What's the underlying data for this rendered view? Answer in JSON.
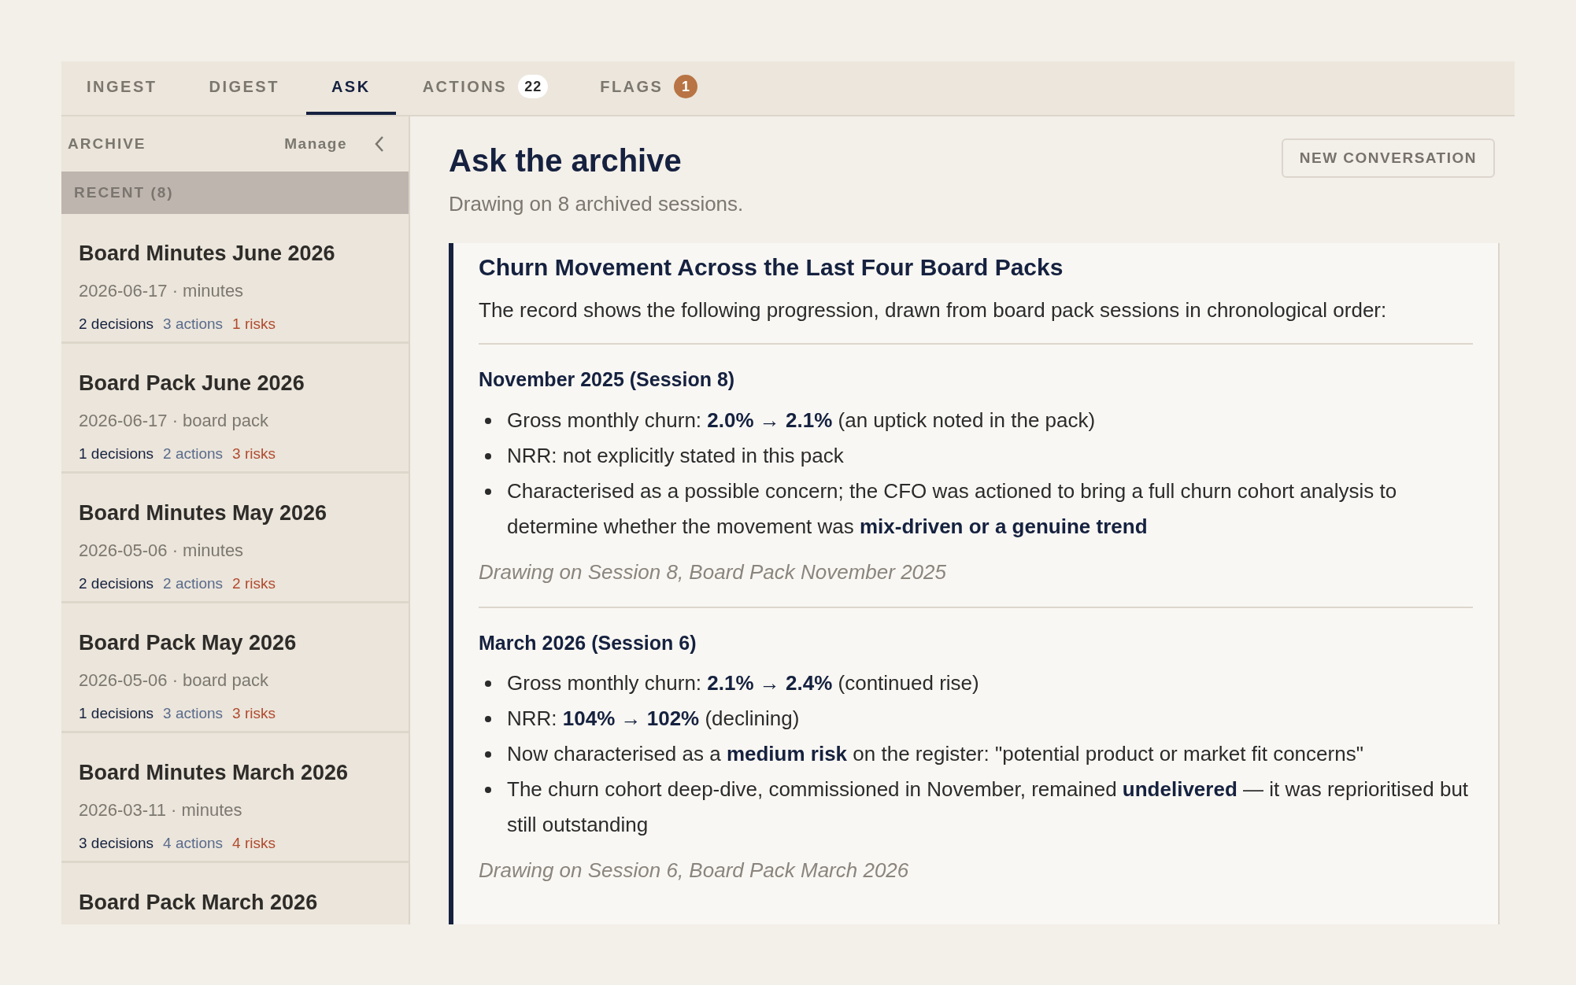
{
  "tabs": [
    {
      "label": "INGEST",
      "selected": false
    },
    {
      "label": "DIGEST",
      "selected": false
    },
    {
      "label": "ASK",
      "selected": true
    },
    {
      "label": "ACTIONS",
      "selected": false,
      "badge": {
        "text": "22",
        "kind": "neutral"
      }
    },
    {
      "label": "FLAGS",
      "selected": false,
      "badge": {
        "text": "1",
        "kind": "alert"
      }
    }
  ],
  "sidebar": {
    "title": "ARCHIVE",
    "manage": "Manage",
    "group": "RECENT (8)",
    "items": [
      {
        "title": "Board Minutes June 2026",
        "meta": "2026-06-17 · minutes",
        "decisions": "2 decisions",
        "actions": "3 actions",
        "risks": "1 risks"
      },
      {
        "title": "Board Pack June 2026",
        "meta": "2026-06-17 · board pack",
        "decisions": "1 decisions",
        "actions": "2 actions",
        "risks": "3 risks"
      },
      {
        "title": "Board Minutes May 2026",
        "meta": "2026-05-06 · minutes",
        "decisions": "2 decisions",
        "actions": "2 actions",
        "risks": "2 risks"
      },
      {
        "title": "Board Pack May 2026",
        "meta": "2026-05-06 · board pack",
        "decisions": "1 decisions",
        "actions": "3 actions",
        "risks": "3 risks"
      },
      {
        "title": "Board Minutes March 2026",
        "meta": "2026-03-11 · minutes",
        "decisions": "3 decisions",
        "actions": "4 actions",
        "risks": "4 risks"
      },
      {
        "title": "Board Pack March 2026"
      }
    ]
  },
  "main": {
    "title": "Ask the archive",
    "subtitle": "Drawing on 8 archived sessions.",
    "new_button": "NEW CONVERSATION",
    "answer": {
      "title": "Churn Movement Across the Last Four Board Packs",
      "intro": "The record shows the following progression, drawn from board pack sessions in chronological order:",
      "sections": [
        {
          "heading": "November 2025 (Session 8)",
          "bullets": [
            "Gross monthly churn: **2.0% → 2.1%** (an uptick noted in the pack)",
            "NRR: not explicitly stated in this pack",
            "Characterised as a possible concern; the CFO was actioned to bring a full churn cohort analysis to determine whether the movement was **mix-driven or a genuine trend**"
          ],
          "citation": "Drawing on Session 8, Board Pack November 2025"
        },
        {
          "heading": "March 2026 (Session 6)",
          "bullets": [
            "Gross monthly churn: **2.1% → 2.4%** (continued rise)",
            "NRR: **104% → 102%** (declining)",
            "Now characterised as a **medium risk** on the register: \"potential product or market fit concerns\"",
            "The churn cohort deep-dive, commissioned in November, remained **undelivered** — it was reprioritised but still outstanding"
          ],
          "citation": "Drawing on Session 6, Board Pack March 2026"
        }
      ]
    }
  }
}
